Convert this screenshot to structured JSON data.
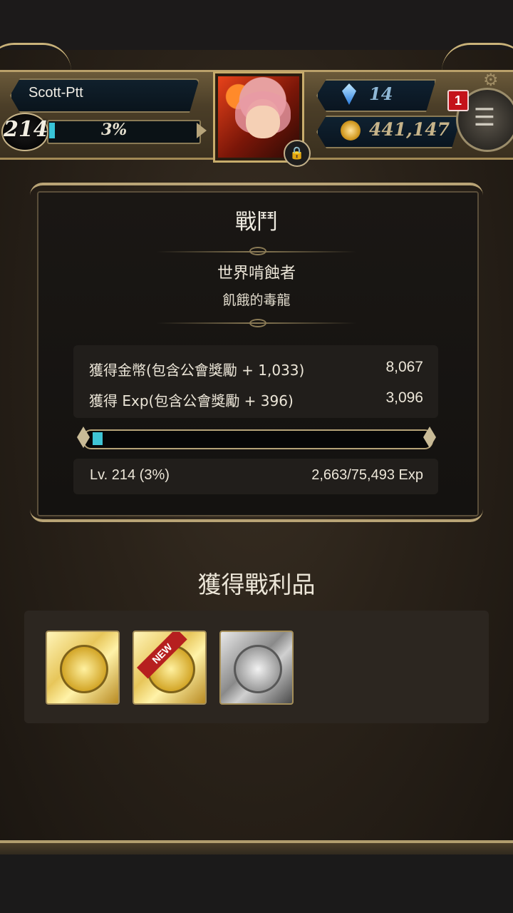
{
  "player": {
    "name": "Scott-Ptt",
    "level": "214",
    "exp_percent_label": "3%",
    "exp_fraction": 0.03
  },
  "currency": {
    "gems": "14",
    "gold": "441,147"
  },
  "notifications": {
    "count": "1"
  },
  "battle": {
    "title": "戰鬥",
    "stage": "世界啃蝕者",
    "boss": "飢餓的毒龍",
    "rewards": [
      {
        "label": "獲得金幣(包含公會獎勵 + 1,033)",
        "value": "8,067"
      },
      {
        "label": "獲得 Exp(包含公會獎勵 + 396)",
        "value": "3,096"
      }
    ],
    "level_bar_fraction": 0.03,
    "level_label": "Lv. 214 (3%)",
    "exp_label": "2,663/75,493 Exp"
  },
  "loot": {
    "title": "獲得戰利品",
    "items": [
      {
        "type": "gold-card",
        "is_new": false
      },
      {
        "type": "gold-card",
        "is_new": true,
        "badge": "NEW"
      },
      {
        "type": "silver-card",
        "is_new": false
      }
    ]
  },
  "icons": {
    "gem": "gem-icon",
    "gold": "gold-coin-icon",
    "lock": "lock-icon",
    "menu": "menu-icon",
    "gear": "gear-icon"
  },
  "colors": {
    "exp_fill": "#38c4d8",
    "notification": "#c4121a",
    "new_ribbon": "#b61f1f"
  }
}
